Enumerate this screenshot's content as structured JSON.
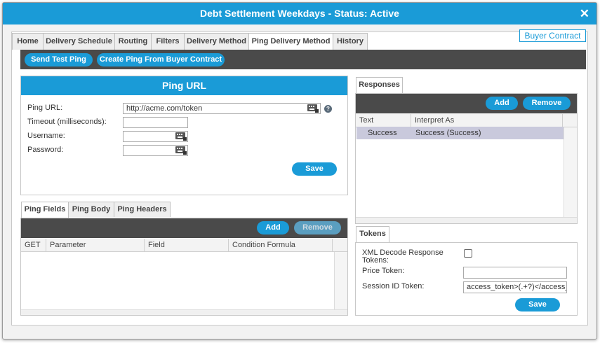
{
  "window": {
    "title": "Debt Settlement Weekdays - Status: Active",
    "close_glyph": "✕"
  },
  "tabs": [
    {
      "label": "Home"
    },
    {
      "label": "Delivery Schedule"
    },
    {
      "label": "Routing"
    },
    {
      "label": "Filters"
    },
    {
      "label": "Delivery Method"
    },
    {
      "label": "Ping Delivery Method",
      "active": true
    },
    {
      "label": "History"
    }
  ],
  "buyer_contract_label": "Buyer Contract",
  "toolbar": {
    "send_test_ping": "Send Test Ping",
    "create_ping": "Create Ping From Buyer Contract"
  },
  "ping_url": {
    "header": "Ping URL",
    "fields": [
      {
        "label": "Ping URL:",
        "value": "http://acme.com/token"
      },
      {
        "label": "Timeout (milliseconds):",
        "value": ""
      },
      {
        "label": "Username:",
        "value": ""
      },
      {
        "label": "Password:",
        "value": ""
      }
    ],
    "help_glyph": "?",
    "save_label": "Save"
  },
  "ping_tabs": [
    {
      "label": "Ping Fields",
      "active": true
    },
    {
      "label": "Ping Body"
    },
    {
      "label": "Ping Headers"
    }
  ],
  "ping_fields": {
    "add_label": "Add",
    "remove_label": "Remove",
    "columns": [
      "GET",
      "Parameter",
      "Field",
      "Condition Formula"
    ],
    "rows": []
  },
  "responses": {
    "tab_label": "Responses",
    "add_label": "Add",
    "remove_label": "Remove",
    "columns": [
      "Text",
      "Interpret As"
    ],
    "rows": [
      {
        "text": "Success",
        "interpret": "Success (Success)"
      }
    ]
  },
  "tokens": {
    "tab_label": "Tokens",
    "xml_decode_label": "XML Decode Response Tokens:",
    "xml_decode_checked": false,
    "price_token_label": "Price Token:",
    "price_token_value": "",
    "session_token_label": "Session ID Token:",
    "session_token_value": "access_token>(.+?)</access_",
    "save_label": "Save"
  },
  "colors": {
    "accent": "#1a9bd7",
    "toolbar": "#4a4a4a",
    "selected_row": "#c9c9dc"
  }
}
